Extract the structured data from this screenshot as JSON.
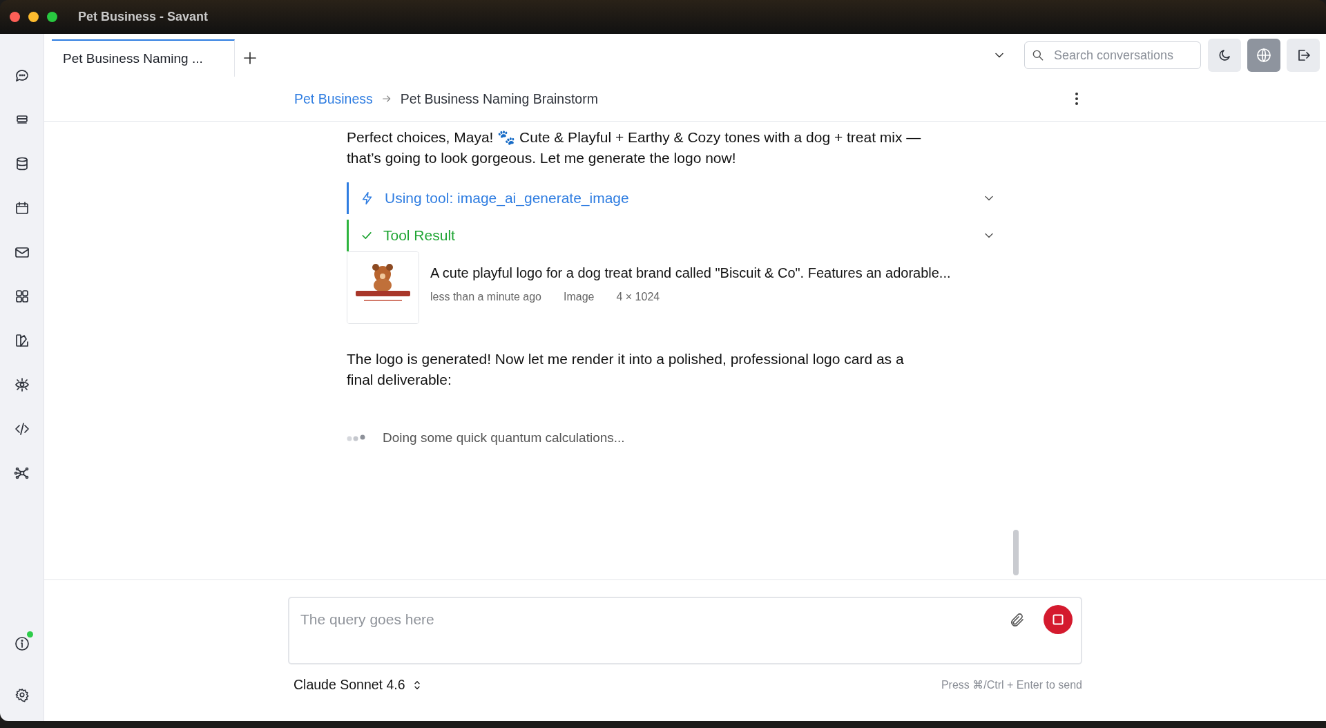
{
  "window": {
    "title": "Pet Business - Savant"
  },
  "sidebar": {
    "info_notification": true
  },
  "tabs": [
    {
      "label": "Pet Business Naming ...",
      "selected": true
    }
  ],
  "search": {
    "placeholder": "Search conversations"
  },
  "toolbar": [
    {
      "kind": "theme",
      "selected": false
    },
    {
      "kind": "globe",
      "selected": true
    },
    {
      "kind": "logout",
      "selected": false
    }
  ],
  "breadcrumb": {
    "parent": "Pet Business",
    "current": "Pet Business Naming Brainstorm"
  },
  "messages": [
    {
      "kind": "text",
      "text": "Perfect choices, Maya! 🐾 Cute & Playful + Earthy & Cozy tones with a dog + treat mix — that’s going to look gorgeous. Let me generate the logo now!"
    },
    {
      "kind": "tool_call",
      "label": "Using tool: image_ai_generate_image",
      "expanded": false
    },
    {
      "kind": "tool_result",
      "label": "Tool Result",
      "expanded": false
    },
    {
      "kind": "attachment",
      "title": "A cute playful logo for a dog treat brand called \"Biscuit & Co\". Features an adorable...",
      "time": "less than a minute ago",
      "type": "Image",
      "size": "4 × 1024"
    },
    {
      "kind": "text",
      "text": "The logo is generated! Now let me render it into a polished, professional logo card as a final deliverable:"
    },
    {
      "kind": "status",
      "text": "Doing some quick quantum calculations..."
    }
  ],
  "composer": {
    "placeholder": "The query goes here",
    "model": "Claude Sonnet 4.6",
    "hint": "Press ⌘/Ctrl + Enter to send"
  }
}
